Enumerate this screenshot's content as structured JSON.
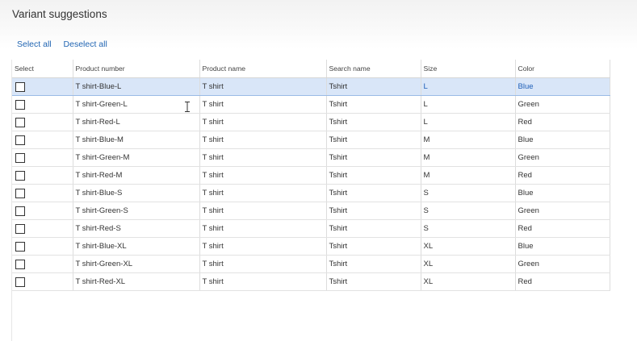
{
  "dialog": {
    "title": "Variant suggestions"
  },
  "actions": {
    "select_all": "Select all",
    "deselect_all": "Deselect all"
  },
  "table": {
    "headers": {
      "select": "Select",
      "product_number": "Product number",
      "product_name": "Product name",
      "search_name": "Search name",
      "size": "Size",
      "color": "Color"
    },
    "rows": [
      {
        "product_number": "T shirt-Blue-L",
        "product_name": "T shirt",
        "search_name": "Tshirt",
        "size": "L",
        "color": "Blue"
      },
      {
        "product_number": "T shirt-Green-L",
        "product_name": "T shirt",
        "search_name": "Tshirt",
        "size": "L",
        "color": "Green"
      },
      {
        "product_number": "T shirt-Red-L",
        "product_name": "T shirt",
        "search_name": "Tshirt",
        "size": "L",
        "color": "Red"
      },
      {
        "product_number": "T shirt-Blue-M",
        "product_name": "T shirt",
        "search_name": "Tshirt",
        "size": "M",
        "color": "Blue"
      },
      {
        "product_number": "T shirt-Green-M",
        "product_name": "T shirt",
        "search_name": "Tshirt",
        "size": "M",
        "color": "Green"
      },
      {
        "product_number": "T shirt-Red-M",
        "product_name": "T shirt",
        "search_name": "Tshirt",
        "size": "M",
        "color": "Red"
      },
      {
        "product_number": "T shirt-Blue-S",
        "product_name": "T shirt",
        "search_name": "Tshirt",
        "size": "S",
        "color": "Blue"
      },
      {
        "product_number": "T shirt-Green-S",
        "product_name": "T shirt",
        "search_name": "Tshirt",
        "size": "S",
        "color": "Green"
      },
      {
        "product_number": "T shirt-Red-S",
        "product_name": "T shirt",
        "search_name": "Tshirt",
        "size": "S",
        "color": "Red"
      },
      {
        "product_number": "T shirt-Blue-XL",
        "product_name": "T shirt",
        "search_name": "Tshirt",
        "size": "XL",
        "color": "Blue"
      },
      {
        "product_number": "T shirt-Green-XL",
        "product_name": "T shirt",
        "search_name": "Tshirt",
        "size": "XL",
        "color": "Green"
      },
      {
        "product_number": "T shirt-Red-XL",
        "product_name": "T shirt",
        "search_name": "Tshirt",
        "size": "XL",
        "color": "Red"
      }
    ]
  },
  "colors": {
    "link": "#2266b3",
    "selected_row": "#d9e6f8"
  },
  "icons": {
    "cursor": "text-cursor-icon"
  }
}
